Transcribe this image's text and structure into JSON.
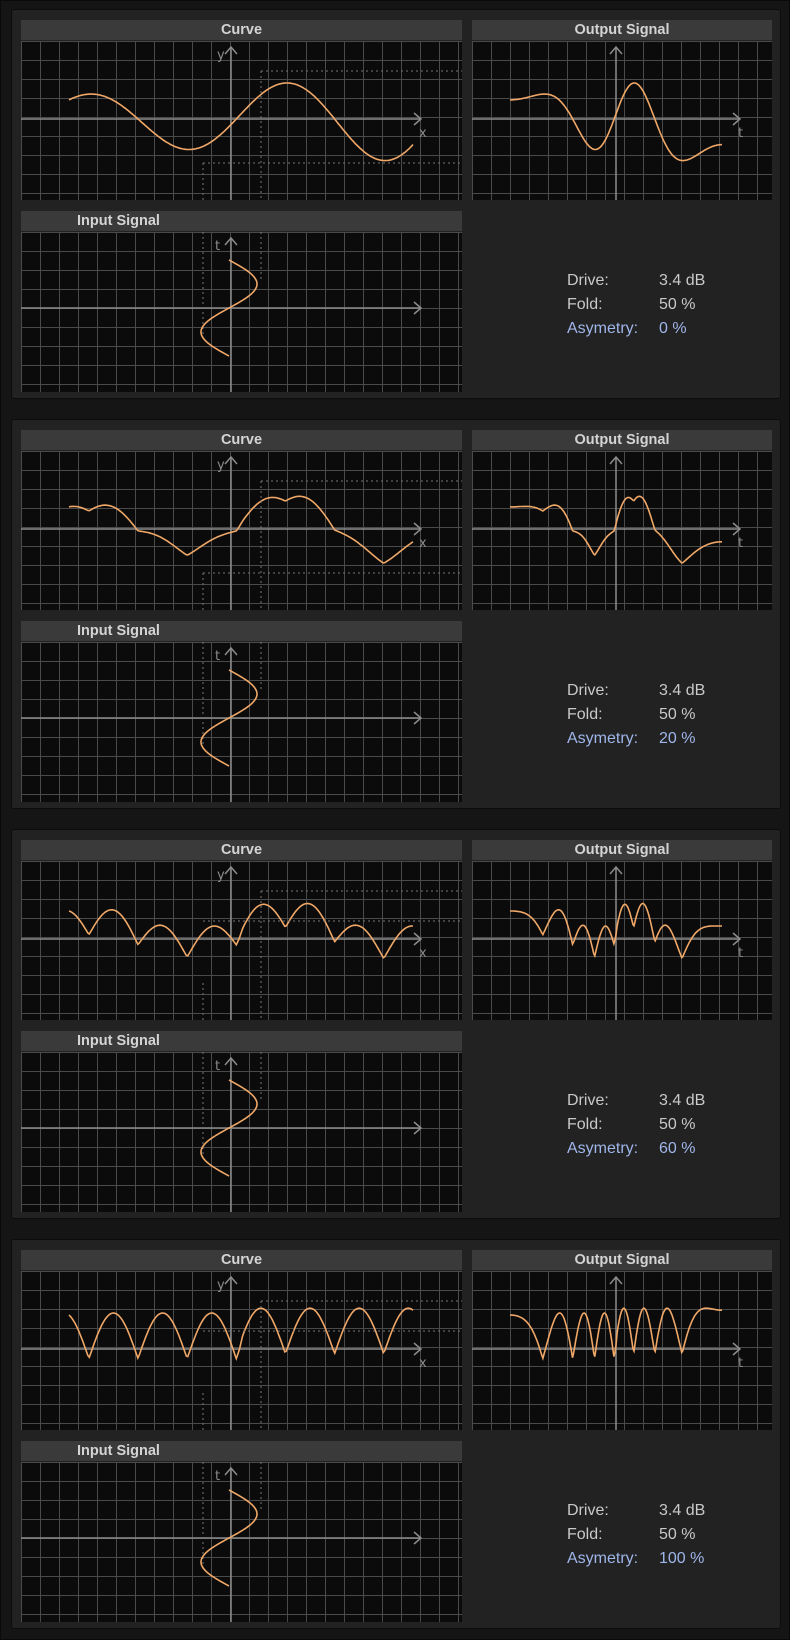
{
  "panels": [
    {
      "curve_title": "Curve",
      "output_title": "Output Signal",
      "input_title": "Input Signal",
      "drive_label": "Drive:",
      "drive_value": "3.4 dB",
      "fold_label": "Fold:",
      "fold_value": "50 %",
      "asym_label": "Asymetry:",
      "asym_value": "0 %",
      "asymmetry": 0.0
    },
    {
      "curve_title": "Curve",
      "output_title": "Output Signal",
      "input_title": "Input Signal",
      "drive_label": "Drive:",
      "drive_value": "3.4 dB",
      "fold_label": "Fold:",
      "fold_value": "50 %",
      "asym_label": "Asymetry:",
      "asym_value": "20 %",
      "asymmetry": 0.2
    },
    {
      "curve_title": "Curve",
      "output_title": "Output Signal",
      "input_title": "Input Signal",
      "drive_label": "Drive:",
      "drive_value": "3.4 dB",
      "fold_label": "Fold:",
      "fold_value": "50 %",
      "asym_label": "Asymetry:",
      "asym_value": "60 %",
      "asymmetry": 0.6
    },
    {
      "curve_title": "Curve",
      "output_title": "Output Signal",
      "input_title": "Input Signal",
      "drive_label": "Drive:",
      "drive_value": "3.4 dB",
      "fold_label": "Fold:",
      "fold_value": "50 %",
      "asym_label": "Asymetry:",
      "asym_value": "100 %",
      "asymmetry": 1.0
    }
  ],
  "axis_labels": {
    "curve_x": "x",
    "curve_y": "y",
    "output_t": "t",
    "input_t": "t"
  },
  "colors": {
    "curve": "#f0a868",
    "grid": "#4a4a4a",
    "axis": "#8c8c8c",
    "highlight": "#9fb6ea"
  }
}
